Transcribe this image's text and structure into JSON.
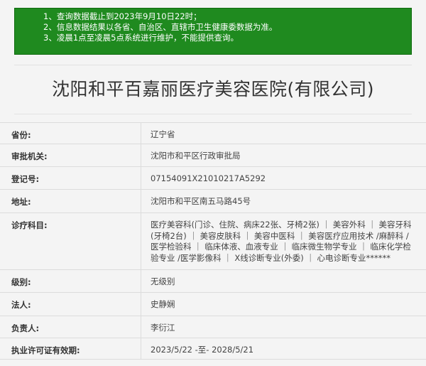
{
  "notice": {
    "lines": [
      "1、查询数据截止到2023年9月10日22时；",
      "2、信息数据结果以各省、自治区、直辖市卫生健康委数据为准。",
      "3、凌晨1点至凌晨5点系统进行维护，不能提供查询。"
    ]
  },
  "title": "沈阳和平百嘉丽医疗美容医院(有限公司)",
  "fields": {
    "province": {
      "label": "省份:",
      "value": "辽宁省"
    },
    "approval": {
      "label": "审批机关:",
      "value": "沈阳市和平区行政审批局"
    },
    "reg_no": {
      "label": "登记号:",
      "value": "07154091X21010217A5292"
    },
    "address": {
      "label": "地址:",
      "value": "沈阳市和平区南五马路45号"
    },
    "departments": {
      "label": "诊疗科目:",
      "value": "医疗美容科(门诊、住院、病床22张、牙椅2张) ｜ 美容外科 ｜ 美容牙科(牙椅2台) ｜ 美容皮肤科 ｜ 美容中医科 ｜ 美容医疗应用技术 /麻醉科 /医学检验科 ｜ 临床体液、血液专业 ｜ 临床微生物学专业 ｜ 临床化学检验专业 /医学影像科 ｜ X线诊断专业(外委) ｜ 心电诊断专业******"
    },
    "level": {
      "label": "级别:",
      "value": "无级别"
    },
    "legal_rep": {
      "label": "法人:",
      "value": "史静娴"
    },
    "person_in_charge": {
      "label": "负责人:",
      "value": "李衍江"
    },
    "validity": {
      "label": "执业许可证有效期:",
      "value": "2023/5/22 -至- 2028/5/21"
    }
  }
}
